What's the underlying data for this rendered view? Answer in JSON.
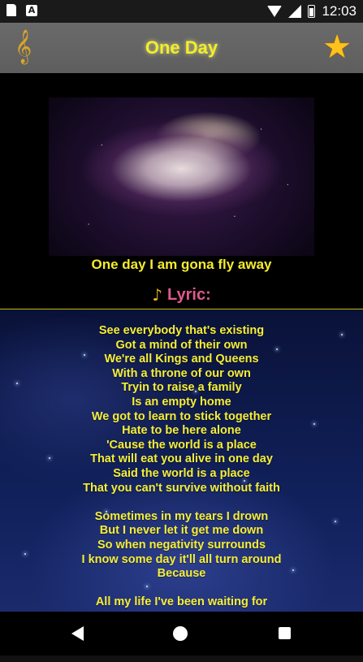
{
  "status_bar": {
    "time": "12:03",
    "icons": [
      "sd-card-icon",
      "a-icon",
      "wifi-icon",
      "signal-icon",
      "battery-icon"
    ],
    "a_icon_text": "A"
  },
  "app_bar": {
    "title": "One Day",
    "left_icon": "treble-clef-icon",
    "right_icon": "star-icon",
    "title_color": "#f2ee2a"
  },
  "video": {
    "caption": "One day I am gona fly away"
  },
  "lyrics": {
    "header_icon": "music-note-icon",
    "header_label": "Lyric:",
    "lines": [
      "See everybody that's existing",
      "Got a mind of their own",
      "We're all Kings and Queens",
      "With a throne of our own",
      "Tryin to raise a family",
      "Is an empty home",
      "We got to learn to stick together",
      "Hate to be here alone",
      "'Cause the world is a place",
      "That will eat you alive in one day",
      "Said the world is a place",
      "That you can't survive without faith",
      "",
      "Sometimes in my tears I drown",
      "But I never let it get me down",
      "So when negativity surrounds",
      "I know some day it'll all turn around",
      "Because",
      "",
      "All my life I've been waiting for"
    ]
  },
  "nav_bar": {
    "icons": [
      "back-icon",
      "home-icon",
      "recents-icon"
    ]
  },
  "colors": {
    "lyric_text": "#f6ee35",
    "lyric_label": "#e05a8c",
    "app_bar_bg": "#636363"
  }
}
